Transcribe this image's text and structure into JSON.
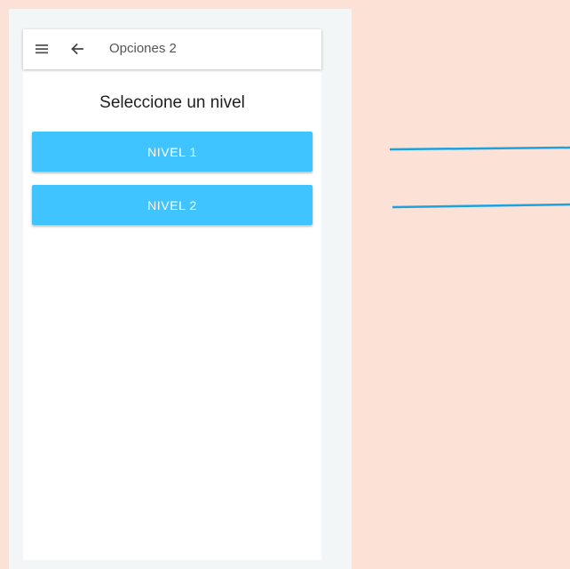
{
  "app_bar": {
    "title": "Opciones 2",
    "menu_icon": "hamburger-menu-icon",
    "back_icon": "arrow-left-icon"
  },
  "main": {
    "heading": "Seleccione un nivel",
    "buttons": [
      {
        "label": "NIVEL 1"
      },
      {
        "label": "NIVEL 2"
      }
    ]
  },
  "colors": {
    "background": "#fbe1d6",
    "frame": "#f3f6f6",
    "button": "#40c4ff",
    "annotation_line": "#1aa3e0"
  }
}
